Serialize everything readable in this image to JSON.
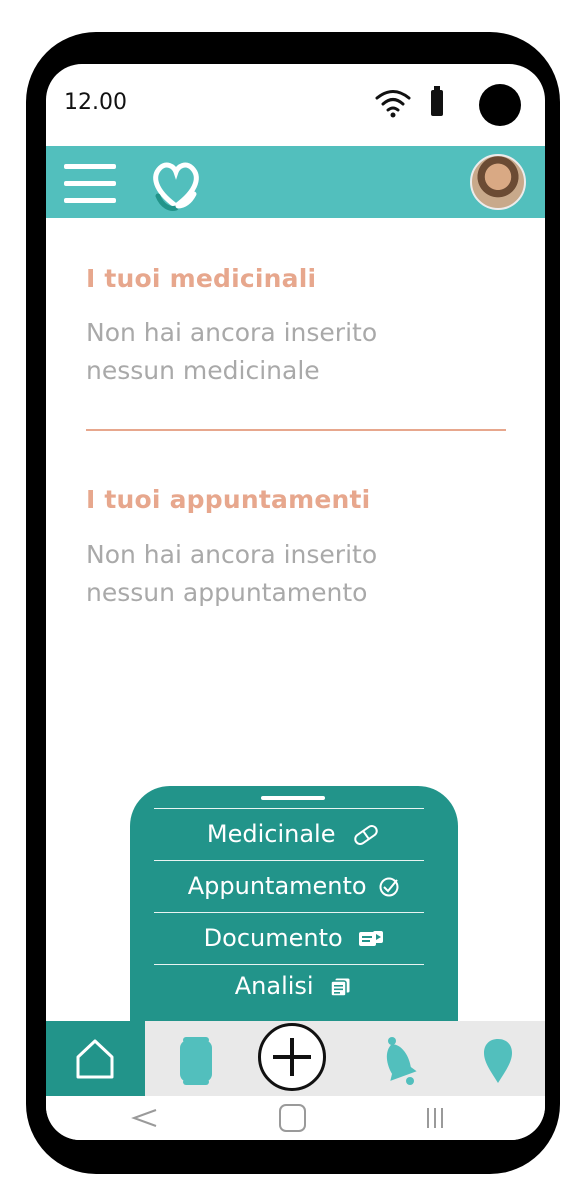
{
  "status_bar": {
    "time": "12.00"
  },
  "home": {
    "medicines": {
      "title": "I tuoi medicinali",
      "empty_line1": "Non hai ancora inserito",
      "empty_line2": "nessun medicinale"
    },
    "appointments": {
      "title": "I tuoi appuntamenti",
      "empty_line1": "Non hai ancora inserito",
      "empty_line2": "nessun appuntamento"
    }
  },
  "add_menu": {
    "items": [
      {
        "label": "Medicinale",
        "icon": "pill-icon"
      },
      {
        "label": "Appuntamento",
        "icon": "check-circle-icon"
      },
      {
        "label": "Documento",
        "icon": "document-icon"
      },
      {
        "label": "Analisi",
        "icon": "analysis-icon"
      }
    ]
  },
  "tabs": [
    "home-icon",
    "medicine-box-icon",
    "add-icon",
    "bell-icon",
    "location-icon"
  ],
  "colors": {
    "teal": "#52bfbd",
    "dark_teal": "#22948a",
    "accent": "#e7a78d",
    "muted_text": "#a9a9a9"
  }
}
